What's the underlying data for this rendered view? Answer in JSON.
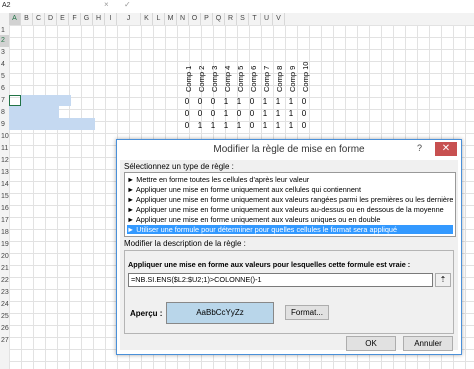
{
  "formula_bar": {
    "name_box": "A2",
    "cancel_glyph": "×",
    "enter_glyph": "✓"
  },
  "columns": [
    "A",
    "B",
    "C",
    "D",
    "E",
    "F",
    "G",
    "H",
    "I",
    "J",
    "K",
    "L",
    "M",
    "N",
    "O",
    "P",
    "Q",
    "R",
    "S",
    "T",
    "U",
    "V"
  ],
  "rows": [
    "1",
    "2",
    "3",
    "4",
    "5",
    "6",
    "7",
    "8",
    "9",
    "10",
    "11",
    "12",
    "13",
    "14",
    "15",
    "16",
    "17",
    "18",
    "19",
    "20",
    "21",
    "22",
    "23",
    "24",
    "25",
    "26",
    "27"
  ],
  "sheet": {
    "headers": [
      "Comp 1",
      "Comp 2",
      "Comp 3",
      "Comp 4",
      "Comp 5",
      "Comp 6",
      "Comp 7",
      "Comp 8",
      "Comp 9",
      "Comp 10"
    ],
    "values": [
      [
        "0",
        "0",
        "0",
        "1",
        "1",
        "0",
        "1",
        "1",
        "1",
        "0"
      ],
      [
        "0",
        "0",
        "0",
        "1",
        "0",
        "0",
        "1",
        "1",
        "1",
        "0"
      ],
      [
        "0",
        "1",
        "1",
        "1",
        "1",
        "0",
        "1",
        "1",
        "1",
        "0"
      ]
    ]
  },
  "dialog": {
    "title": "Modifier la règle de mise en forme",
    "help": "?",
    "close": "✕",
    "rule_type_label": "Sélectionnez un type de règle :",
    "rule_types": [
      "► Mettre en forme toutes les cellules d'après leur valeur",
      "► Appliquer une mise en forme uniquement aux cellules qui contiennent",
      "► Appliquer une mise en forme uniquement aux valeurs rangées parmi les premières ou les dernières valeurs",
      "► Appliquer une mise en forme uniquement aux valeurs au-dessus ou en dessous de la moyenne",
      "► Appliquer une mise en forme uniquement aux valeurs uniques ou en double",
      "► Utiliser une formule pour déterminer pour quelles cellules le format sera appliqué"
    ],
    "selected_rule_index": 5,
    "desc_label": "Modifier la description de la règle :",
    "formula_label": "Appliquer une mise en forme aux valeurs pour lesquelles cette formule est vraie :",
    "formula_value": "=NB.SI.ENS($L2:$U2;1)>COLONNE()-1",
    "preview_label": "Aperçu :",
    "preview_text": "AaBbCcYyZz",
    "format_button": "Format...",
    "ok_button": "OK",
    "cancel_button": "Annuler"
  },
  "colors": {
    "accent": "#217346",
    "selection": "#3399ff",
    "highlight": "#c5d9f1",
    "preview": "#b9d6ea",
    "close": "#c75050"
  }
}
